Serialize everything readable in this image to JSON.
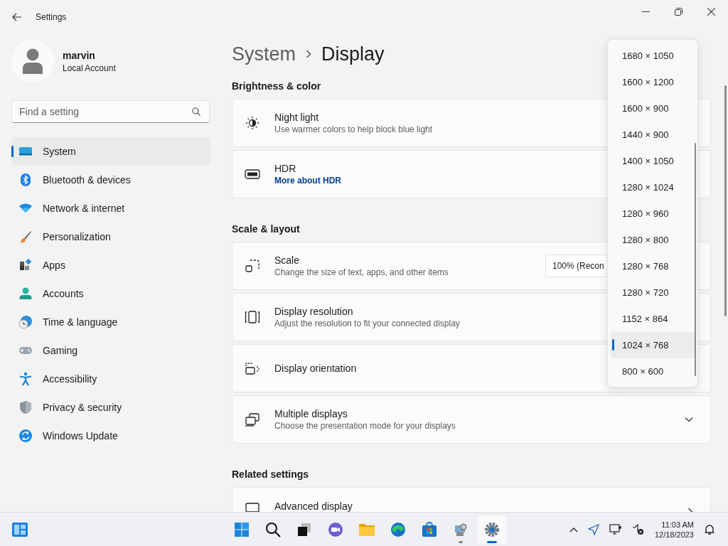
{
  "window": {
    "title": "Settings"
  },
  "user": {
    "name": "marvin",
    "account_type": "Local Account"
  },
  "search": {
    "placeholder": "Find a setting"
  },
  "nav": [
    {
      "kind": "system",
      "label": "System",
      "selected": true
    },
    {
      "kind": "bluetooth",
      "label": "Bluetooth & devices",
      "selected": false
    },
    {
      "kind": "network",
      "label": "Network & internet",
      "selected": false
    },
    {
      "kind": "personalization",
      "label": "Personalization",
      "selected": false
    },
    {
      "kind": "apps",
      "label": "Apps",
      "selected": false
    },
    {
      "kind": "accounts",
      "label": "Accounts",
      "selected": false
    },
    {
      "kind": "time",
      "label": "Time & language",
      "selected": false
    },
    {
      "kind": "gaming",
      "label": "Gaming",
      "selected": false
    },
    {
      "kind": "accessibility",
      "label": "Accessibility",
      "selected": false
    },
    {
      "kind": "privacy",
      "label": "Privacy & security",
      "selected": false
    },
    {
      "kind": "update",
      "label": "Windows Update",
      "selected": false
    }
  ],
  "breadcrumb": {
    "parent": "System",
    "current": "Display"
  },
  "sections": [
    {
      "heading": "Brightness & color",
      "cards": [
        {
          "kind": "night-light",
          "title": "Night light",
          "subtitle": "Use warmer colors to help block blue light"
        },
        {
          "kind": "hdr",
          "title": "HDR",
          "link": "More about HDR"
        }
      ]
    },
    {
      "heading": "Scale & layout",
      "cards": [
        {
          "kind": "scale",
          "title": "Scale",
          "subtitle": "Change the size of text, apps, and other items",
          "value": "100% (Recon"
        },
        {
          "kind": "resolution",
          "title": "Display resolution",
          "subtitle": "Adjust the resolution to fit your connected display"
        },
        {
          "kind": "orientation",
          "title": "Display orientation"
        },
        {
          "kind": "multiple",
          "title": "Multiple displays",
          "subtitle": "Choose the presentation mode for your displays"
        }
      ]
    },
    {
      "heading": "Related settings",
      "cards": [
        {
          "kind": "advanced",
          "title": "Advanced display"
        }
      ]
    }
  ],
  "resolution_options": [
    {
      "label": "1680 × 1050",
      "selected": false
    },
    {
      "label": "1600 × 1200",
      "selected": false
    },
    {
      "label": "1600 × 900",
      "selected": false
    },
    {
      "label": "1440 × 900",
      "selected": false
    },
    {
      "label": "1400 × 1050",
      "selected": false
    },
    {
      "label": "1280 × 1024",
      "selected": false
    },
    {
      "label": "1280 × 960",
      "selected": false
    },
    {
      "label": "1280 × 800",
      "selected": false
    },
    {
      "label": "1280 × 768",
      "selected": false
    },
    {
      "label": "1280 × 720",
      "selected": false
    },
    {
      "label": "1152 × 864",
      "selected": false
    },
    {
      "label": "1024 × 768",
      "selected": true
    },
    {
      "label": "800 × 600",
      "selected": false
    }
  ],
  "taskbar": {
    "apps": [
      {
        "kind": "start",
        "open": false,
        "selected": false
      },
      {
        "kind": "search",
        "open": false,
        "selected": false
      },
      {
        "kind": "task-view",
        "open": false,
        "selected": false
      },
      {
        "kind": "chat",
        "open": false,
        "selected": false
      },
      {
        "kind": "folder",
        "open": false,
        "selected": false
      },
      {
        "kind": "browser",
        "open": false,
        "selected": false
      },
      {
        "kind": "store",
        "open": false,
        "selected": false
      },
      {
        "kind": "control-panel",
        "open": true,
        "selected": false
      },
      {
        "kind": "settings",
        "open": true,
        "selected": true
      }
    ],
    "time": "11:03 AM",
    "date": "12/18/2023"
  }
}
